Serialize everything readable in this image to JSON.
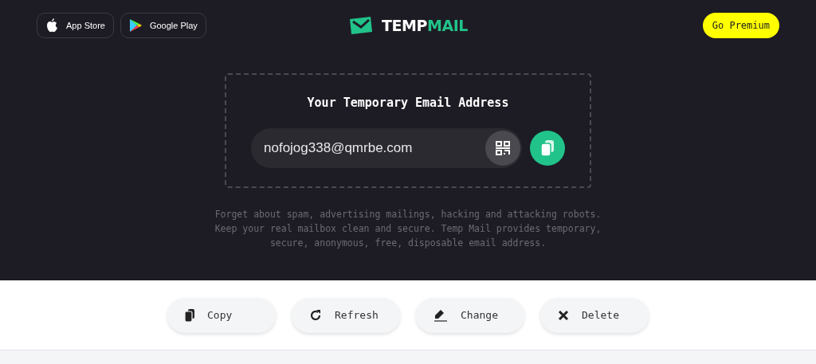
{
  "store_buttons": [
    {
      "kind": "apple",
      "label": "App Store"
    },
    {
      "kind": "play",
      "label": "Google Play"
    }
  ],
  "logo": {
    "text_1": "TEMP",
    "text_2": "MAIL"
  },
  "premium_button": "Go Premium",
  "email_box": {
    "title": "Your Temporary Email Address",
    "value": "nofojog338@qmrbe.com"
  },
  "description": "Forget about spam, advertising mailings, hacking and attacking robots. Keep your real mailbox clean and secure. Temp Mail provides temporary, secure, anonymous, free, disposable email address.",
  "actions": [
    {
      "kind": "copy",
      "label": "Copy"
    },
    {
      "kind": "refresh",
      "label": "Refresh"
    },
    {
      "kind": "change",
      "label": "Change"
    },
    {
      "kind": "delete",
      "label": "Delete"
    }
  ]
}
